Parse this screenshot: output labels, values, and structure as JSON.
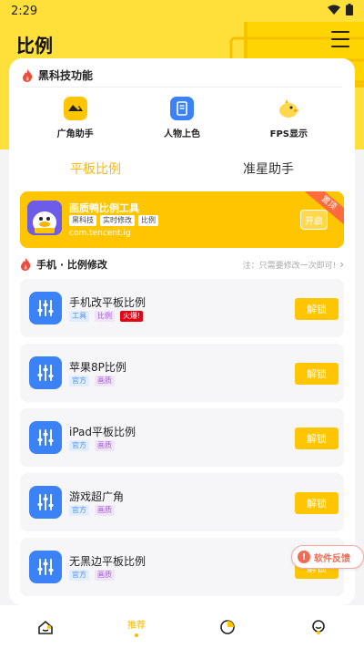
{
  "status": {
    "time": "2:29"
  },
  "header": {
    "title": "比例"
  },
  "tech": {
    "title": "黑科技功能",
    "items": [
      {
        "label": "广角助手",
        "icon": "wide-angle-icon",
        "color": "#ffc600"
      },
      {
        "label": "人物上色",
        "icon": "document-icon",
        "color": "#3b82f6"
      },
      {
        "label": "FPS显示",
        "icon": "bird-icon",
        "color": "#ffd84d"
      }
    ]
  },
  "tabs": [
    {
      "label": "平板比例",
      "active": true
    },
    {
      "label": "准星助手",
      "active": false
    }
  ],
  "promo": {
    "name": "画质鸭比例工具",
    "tags": [
      "黑科技",
      "实时修改",
      "比例"
    ],
    "package": "com.tencent.ig",
    "button": "开启",
    "ribbon": "置顶"
  },
  "section": {
    "title": "手机 · 比例修改",
    "note": "注：只需要修改一次即可!"
  },
  "items": [
    {
      "name": "手机改平板比例",
      "tags": [
        {
          "t": "工具",
          "c": "blue"
        },
        {
          "t": "比例",
          "c": "purple"
        },
        {
          "t": "火爆!",
          "c": "red"
        }
      ],
      "button": "解锁"
    },
    {
      "name": "苹果8P比例",
      "tags": [
        {
          "t": "官方",
          "c": "blue"
        },
        {
          "t": "画质",
          "c": "purple"
        }
      ],
      "button": "解锁"
    },
    {
      "name": "iPad平板比例",
      "tags": [
        {
          "t": "官方",
          "c": "blue"
        },
        {
          "t": "画质",
          "c": "purple"
        }
      ],
      "button": "解锁"
    },
    {
      "name": "游戏超广角",
      "tags": [
        {
          "t": "官方",
          "c": "blue"
        },
        {
          "t": "画质",
          "c": "purple"
        }
      ],
      "button": "解锁"
    },
    {
      "name": "无黑边平板比例",
      "tags": [
        {
          "t": "官方",
          "c": "blue"
        },
        {
          "t": "画质",
          "c": "purple"
        }
      ],
      "button": "解锁"
    }
  ],
  "feedback": {
    "label": "软件反馈"
  },
  "nav": [
    {
      "label": "",
      "icon": "home-icon"
    },
    {
      "label": "推荐",
      "icon": "",
      "active": true
    },
    {
      "label": "",
      "icon": "pie-chart-icon"
    },
    {
      "label": "",
      "icon": "profile-icon"
    }
  ],
  "colors": {
    "accent": "#ffc600",
    "header": "#ffe03a",
    "item_icon": "#3b82f6"
  }
}
